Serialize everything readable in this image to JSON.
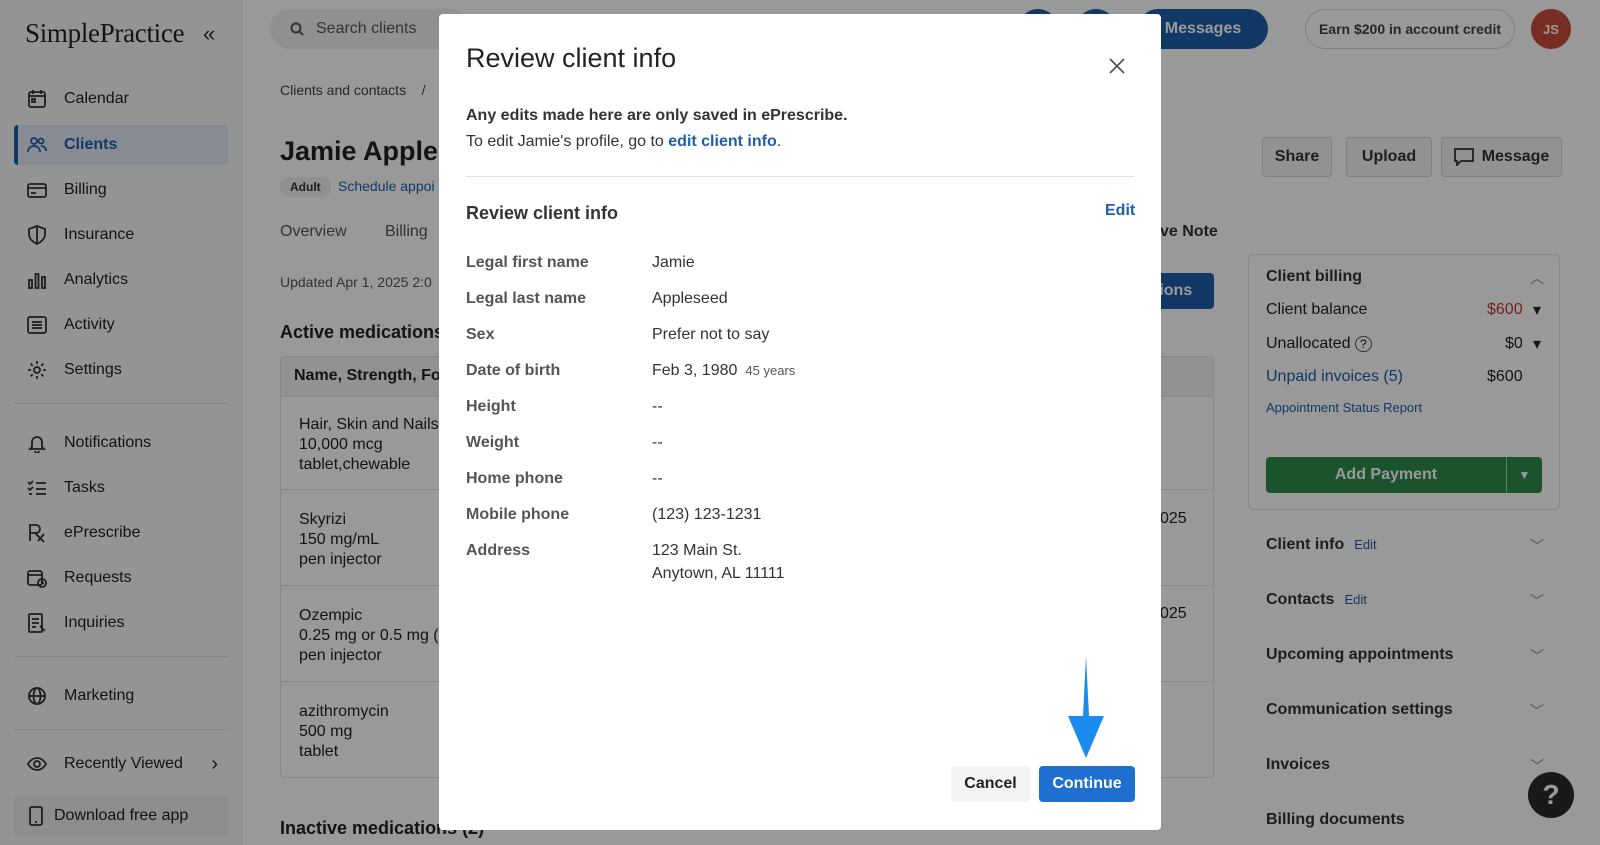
{
  "sidebar": {
    "logo": "SimplePractice",
    "collapse_icon": "«",
    "items": [
      {
        "label": "Calendar",
        "icon": "calendar-icon"
      },
      {
        "label": "Clients",
        "icon": "users-icon"
      },
      {
        "label": "Billing",
        "icon": "credit-card-icon"
      },
      {
        "label": "Insurance",
        "icon": "shield-icon"
      },
      {
        "label": "Analytics",
        "icon": "bar-chart-icon"
      },
      {
        "label": "Activity",
        "icon": "list-icon"
      },
      {
        "label": "Settings",
        "icon": "gear-icon"
      },
      {
        "label": "Notifications",
        "icon": "bell-icon"
      },
      {
        "label": "Tasks",
        "icon": "checklist-icon"
      },
      {
        "label": "ePrescribe",
        "icon": "rx-icon"
      },
      {
        "label": "Requests",
        "icon": "calendar-clock-icon"
      },
      {
        "label": "Inquiries",
        "icon": "document-icon"
      },
      {
        "label": "Marketing",
        "icon": "globe-icon"
      },
      {
        "label": "Recently Viewed",
        "icon": "eye-icon"
      }
    ],
    "active_item": "Clients",
    "download_label": "Download free app"
  },
  "topbar": {
    "search_placeholder": "Search clients",
    "messages_label": "Messages",
    "earn_label": "Earn $200 in account credit",
    "avatar_initials": "JS",
    "brand_color": "#1f5ea8"
  },
  "main": {
    "breadcrumb": "Clients and contacts    /",
    "client_name": "Jamie Apples",
    "adult_badge": "Adult",
    "schedule_link": "Schedule appoi",
    "tabs": [
      "Overview",
      "Billing"
    ],
    "updated": "Updated Apr 1, 2025 2:0",
    "active_medications_heading": "Active medications",
    "table_header": "Name, Strength, Fo",
    "medications": [
      {
        "line1": "Hair, Skin and Nails",
        "line2": "10,000 mcg",
        "line3": "tablet,chewable"
      },
      {
        "line1": "Skyrizi",
        "line2": "150 mg/mL",
        "line3": "pen injector"
      },
      {
        "line1": "Ozempic",
        "line2": "0.25 mg or 0.5 mg (",
        "line3": "pen injector"
      },
      {
        "line1": "azithromycin",
        "line2": "500 mg",
        "line3": "tablet"
      }
    ],
    "date_fragments": [
      "025",
      "025"
    ],
    "inactive_heading": "Inactive medications (2)",
    "actions": {
      "share": "Share",
      "upload": "Upload",
      "message": "Message"
    },
    "note_tab": "ve Note",
    "blue_button_fragment": "tions"
  },
  "right_panel": {
    "client_billing_title": "Client billing",
    "client_balance_label": "Client balance",
    "client_balance_value": "$600",
    "unallocated_label": "Unallocated",
    "unallocated_value": "$0",
    "unpaid_invoices_label": "Unpaid invoices (5)",
    "unpaid_invoices_value": "$600",
    "appointment_status_report": "Appointment Status Report",
    "add_payment_label": "Add Payment",
    "edit_label": "Edit",
    "sections": [
      {
        "title": "Client info",
        "editable": true
      },
      {
        "title": "Contacts",
        "editable": true
      },
      {
        "title": "Upcoming appointments",
        "editable": false
      },
      {
        "title": "Communication settings",
        "editable": false
      },
      {
        "title": "Invoices",
        "editable": false
      },
      {
        "title": "Billing documents",
        "editable": false
      }
    ],
    "balance_color": "#c0392b",
    "payment_color": "#2d8a4a"
  },
  "modal": {
    "title": "Review client info",
    "notice_bold": "Any edits made here are only saved in ePrescribe.",
    "notice_prefix": "To edit Jamie's profile, go to ",
    "notice_link": "edit client info",
    "notice_suffix": ".",
    "section_title": "Review client info",
    "edit_label": "Edit",
    "fields": [
      {
        "label": "Legal first name",
        "value": "Jamie"
      },
      {
        "label": "Legal last name",
        "value": "Appleseed"
      },
      {
        "label": "Sex",
        "value": "Prefer not to say"
      },
      {
        "label": "Date of birth",
        "value": "Feb 3, 1980",
        "extra": "45 years"
      },
      {
        "label": "Height",
        "value": "--"
      },
      {
        "label": "Weight",
        "value": "--"
      },
      {
        "label": "Home phone",
        "value": "--"
      },
      {
        "label": "Mobile phone",
        "value": "(123) 123-1231"
      },
      {
        "label": "Address",
        "value": "123 Main St.",
        "value2": "Anytown, AL 11111"
      }
    ],
    "cancel_label": "Cancel",
    "continue_label": "Continue",
    "accent_color": "#1f6fd0",
    "arrow_color": "#1a8cf0"
  }
}
